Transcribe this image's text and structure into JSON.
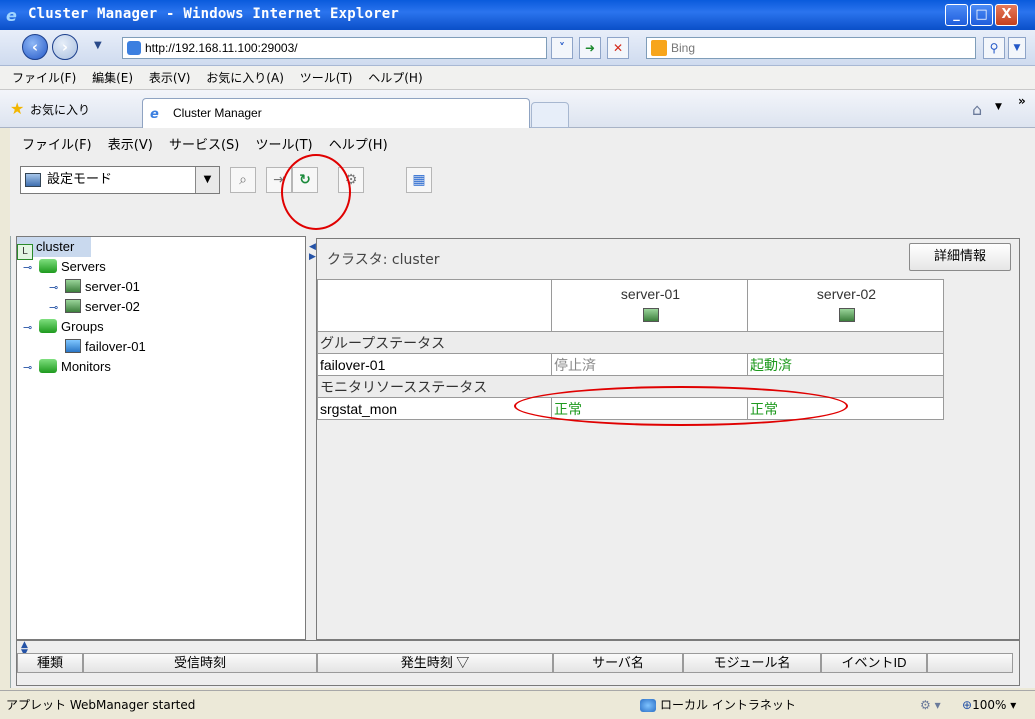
{
  "window": {
    "title": "Cluster Manager - Windows Internet Explorer",
    "min_label": "_",
    "max_label": "□",
    "close_label": "X"
  },
  "browser": {
    "address": "http://192.168.11.100:29003/",
    "search_placeholder": "Bing",
    "menu": [
      "ファイル(F)",
      "編集(E)",
      "表示(V)",
      "お気に入り(A)",
      "ツール(T)",
      "ヘルプ(H)"
    ],
    "favorites_label": "お気に入り",
    "tab_title": "Cluster Manager",
    "zone": "ローカル イントラネット",
    "zoom": "100%",
    "status": "アプレット WebManager started"
  },
  "app": {
    "menu": [
      "ファイル(F)",
      "表示(V)",
      "サービス(S)",
      "ツール(T)",
      "ヘルプ(H)"
    ],
    "mode": "設定モード",
    "tree": {
      "root": "cluster",
      "servers_label": "Servers",
      "servers": [
        "server-01",
        "server-02"
      ],
      "groups_label": "Groups",
      "groups": [
        "failover-01"
      ],
      "monitors_label": "Monitors"
    },
    "panel": {
      "cluster_label": "クラスタ: cluster",
      "detail_button": "詳細情報",
      "servers": [
        "server-01",
        "server-02"
      ],
      "group_status_header": "グループステータス",
      "group_rows": [
        {
          "name": "failover-01",
          "s1": "停止済",
          "s2": "起動済"
        }
      ],
      "monitor_status_header": "モニタリソースステータス",
      "monitor_rows": [
        {
          "name": "srgstat_mon",
          "s1": "正常",
          "s2": "正常"
        }
      ]
    },
    "events": {
      "columns": [
        "種類",
        "受信時刻",
        "発生時刻 ▽",
        "サーバ名",
        "モジュール名",
        "イベントID"
      ]
    }
  }
}
